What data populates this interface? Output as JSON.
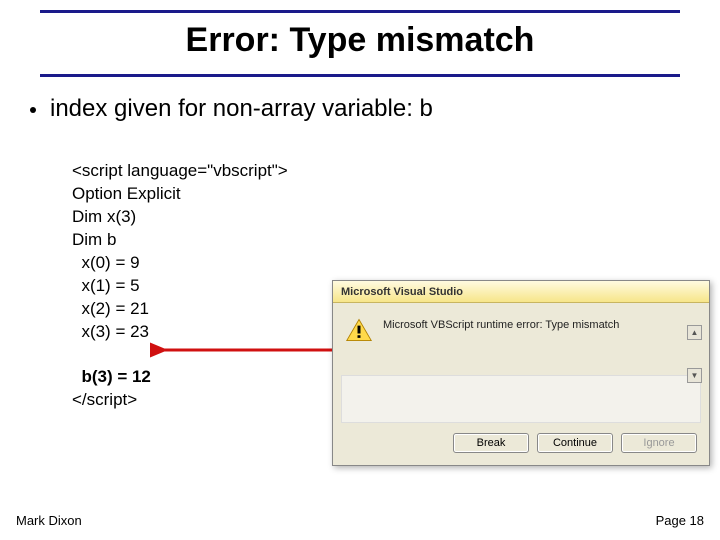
{
  "title": "Error: Type mismatch",
  "bullet": "index given for non-array variable: b",
  "code": {
    "l1": "<script language=\"vbscript\">",
    "l2": "Option Explicit",
    "l3": "Dim x(3)",
    "l4": "Dim b",
    "l5": "  x(0) = 9",
    "l6": "  x(1) = 5",
    "l7": "  x(2) = 21",
    "l8": "  x(3) = 23",
    "blank": " ",
    "l9": "  b(3) = 12",
    "l10": "</script>"
  },
  "dialog": {
    "title": "Microsoft Visual Studio",
    "message": "Microsoft VBScript runtime error: Type mismatch",
    "buttons": {
      "break": "Break",
      "continue": "Continue",
      "ignore": "Ignore"
    }
  },
  "footer": {
    "author": "Mark Dixon",
    "page": "Page 18"
  }
}
